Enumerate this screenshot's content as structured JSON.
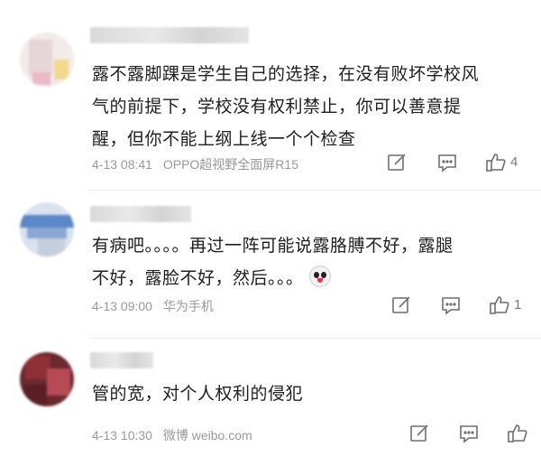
{
  "comments": [
    {
      "text_lines": [
        "露不露脚踝是学生自己的选择，在没有败坏学校风",
        "气的前提下，学校没有权利禁止，你可以善意提",
        "醒，但你不能上纲上线一个个检查"
      ],
      "timestamp": "4-13 08:41",
      "source": "OPPO超视野全面屏R15",
      "like_count": "4"
    },
    {
      "text_lines": [
        "有病吧。。。。再过一阵可能说露胳膊不好，露腿",
        "不好，露脸不好，然后。。。"
      ],
      "timestamp": "4-13 09:00",
      "source": "华为手机",
      "like_count": "1"
    },
    {
      "text_lines": [
        "管的宽，对个人权利的侵犯"
      ],
      "timestamp": "4-13 10:30",
      "source": "微博 weibo.com",
      "like_count": ""
    }
  ],
  "icons": {
    "edit": "edit-icon",
    "reply": "comment-icon",
    "like": "thumbs-up-icon",
    "emoji": "emoji-face-icon"
  },
  "colors": {
    "text": "#202020",
    "meta": "#9a9a9a",
    "icon": "#6f6f6f"
  }
}
